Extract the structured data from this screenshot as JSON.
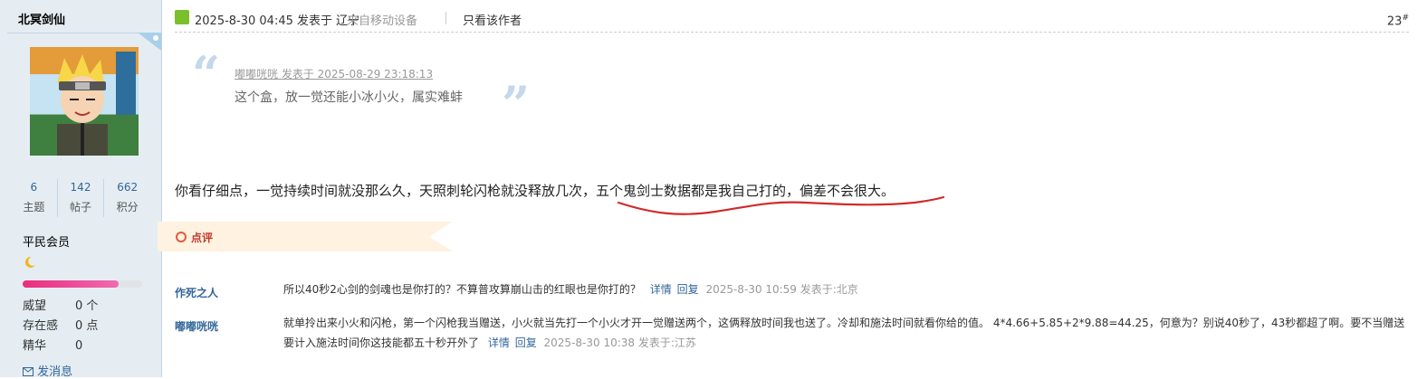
{
  "author": {
    "name": "北冥剑仙",
    "stats": [
      {
        "value": "6",
        "label": "主题"
      },
      {
        "value": "142",
        "label": "帖子"
      },
      {
        "value": "662",
        "label": "积分"
      }
    ],
    "rank": "平民会员",
    "level_progress": 0.8,
    "attributes": [
      {
        "key": "威望",
        "value": "0 个"
      },
      {
        "key": "存在感",
        "value": "0 点"
      },
      {
        "key": "精华",
        "value": "0"
      }
    ],
    "message_link": "发消息"
  },
  "post": {
    "date": "2025-8-30 04:45 发表于 辽宁",
    "source": "来自移动设备",
    "only_author": "只看该作者",
    "floor": "23",
    "floor_mark": "#",
    "quote": {
      "meta": "嘟嘟咣咣 发表于 2025-08-29 23:18:13",
      "text": "这个盒，放一觉还能小冰小火，属实难蚌"
    },
    "body": "你看仔细点，一觉持续时间就没那么久，天照刺轮闪枪就没释放几次，五个鬼剑士数据都是我自己打的，偏差不会很大。"
  },
  "comments_section": {
    "label": "点评",
    "items": [
      {
        "user": "作死之人",
        "text": "所以40秒2心剑的剑魂也是你打的？不算普攻算崩山击的红眼也是你打的？",
        "detail": "详情",
        "reply": "回复",
        "meta": "2025-8-30 10:59 发表于:北京"
      },
      {
        "user": "嘟嘟咣咣",
        "text": "就单拎出来小火和闪枪，第一个闪枪我当赠送，小火就当先打一个小火才开一觉赠送两个，这俩释放时间我也送了。冷却和施法时间就看你给的值。 4*4.66+5.85+2*9.88=44.25，何意为？别说40秒了，43秒都超了啊。要不当赠送要计入施法时间你这技能都五十秒开外了",
        "detail": "详情",
        "reply": "回复",
        "meta": "2025-8-30 10:38 发表于:江苏"
      }
    ]
  },
  "colors": {
    "link": "#336699",
    "sidebar_bg": "#e5edf2",
    "annotation": "#d12a2a",
    "progress": "#ea2c7d"
  }
}
